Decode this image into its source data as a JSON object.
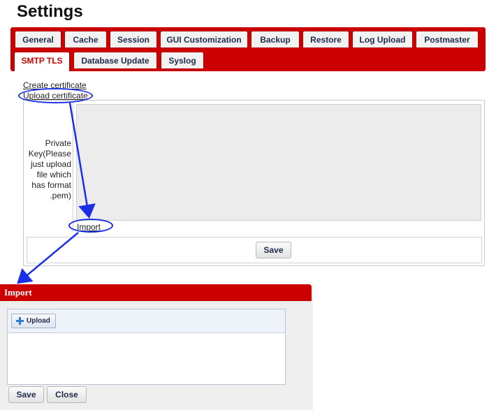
{
  "page": {
    "title": "Settings"
  },
  "tabs": {
    "row1": [
      "General",
      "Cache",
      "Session",
      "GUI Customization",
      "Backup",
      "Restore",
      "Log Upload",
      "Postmaster"
    ],
    "row2": [
      "SMTP TLS",
      "Database Update",
      "Syslog"
    ],
    "active": "SMTP TLS"
  },
  "smtp_tls": {
    "create_certificate": "Create certificate",
    "upload_certificate": "Upload certificate",
    "private_key_label": "Private Key(Please just upload file which has format .pem)",
    "import_link": "Import",
    "save_label": "Save"
  },
  "import_dialog": {
    "title": "Import",
    "upload_label": "Upload",
    "save_label": "Save",
    "close_label": "Close"
  },
  "colors": {
    "accent_red": "#cc0000",
    "annotation_blue": "#1a2ee8"
  }
}
